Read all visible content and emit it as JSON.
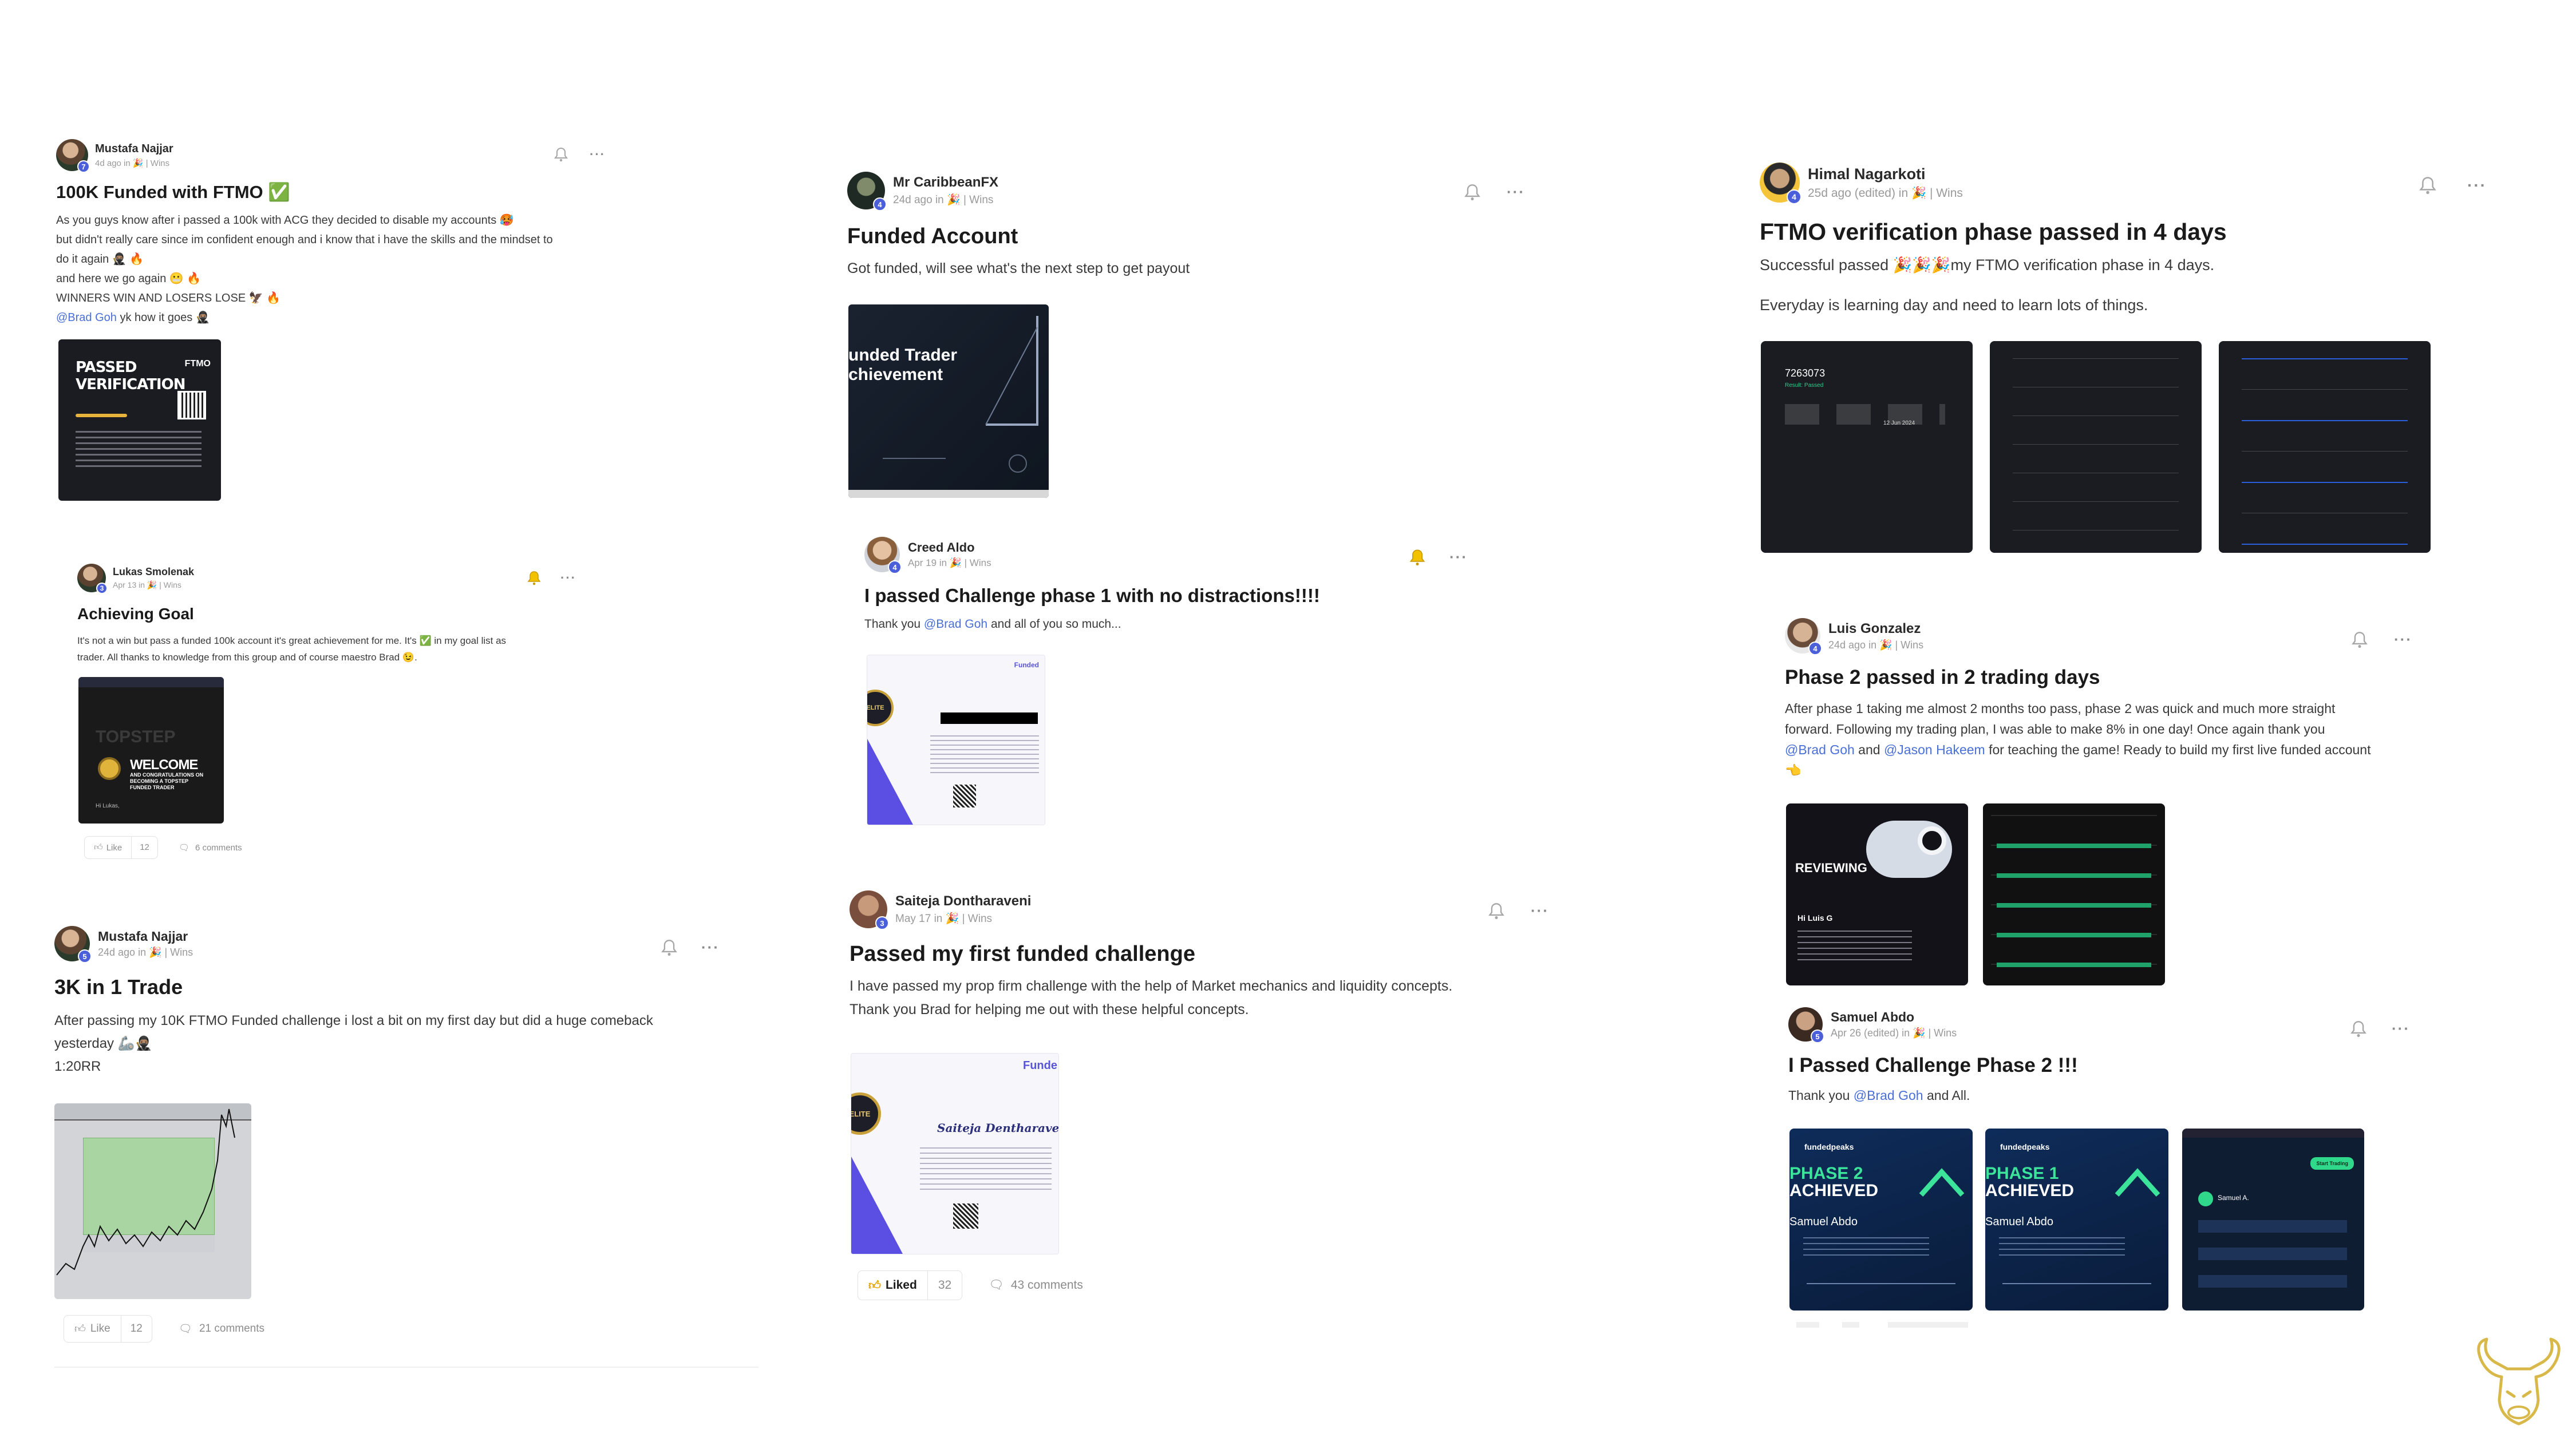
{
  "posts": [
    {
      "author": "Mustafa Najjar",
      "level": "7",
      "meta": "4d ago in 🎉 | Wins",
      "title": "100K Funded with FTMO ✅",
      "lines": [
        "As you guys know after i passed a 100k with ACG they decided to disable my accounts 🥵",
        "but didn't really care since im confident enough and i know that i have the skills and the mindset to",
        "do it again 🥷🏽 🔥",
        "and here we go again 😬 🔥",
        "WINNERS WIN AND LOSERS LOSE 🦅 🔥"
      ],
      "mention_line": {
        "mention": "@Brad Goh",
        "rest": " yk how it goes 🥷🏽"
      },
      "image": {
        "line1": "PASSED",
        "line2": "VERIFICATION",
        "brand": "FTMO"
      }
    },
    {
      "author": "Lukas Smolenak",
      "level": "3",
      "meta": "Apr 13 in 🎉 | Wins",
      "title": "Achieving Goal",
      "lines": [
        "It's not a win but pass a funded 100k account it's great achievement for me. It's ✅ in my goal list as",
        "trader. All thanks to knowledge from this group and of course maestro Brad 😉."
      ],
      "image": {
        "top": "TOPSTEP",
        "welcome": "WELCOME",
        "sub": "AND CONGRATULATIONS ON BECOMING A TOPSTEP FUNDED TRADER",
        "greet": "Hi Lukas,"
      },
      "like_label": "Like",
      "like_count": "12",
      "comments": "6 comments"
    },
    {
      "author": "Mustafa Najjar",
      "level": "5",
      "meta": "24d ago in 🎉 | Wins",
      "title": "3K in 1 Trade",
      "lines": [
        "After passing my 10K FTMO Funded challenge i lost a bit on my first day but did a huge comeback",
        "yesterday 🦾🥷🏽",
        "1:20RR"
      ],
      "like_label": "Like",
      "like_count": "12",
      "comments": "21 comments"
    },
    {
      "author": "Mr CaribbeanFX",
      "level": "4",
      "meta": "24d ago in 🎉 | Wins",
      "title": "Funded Account",
      "lines": [
        "Got funded, will see what's the next step to get payout"
      ],
      "image": {
        "line1": "unded Trader",
        "line2": "chievement"
      }
    },
    {
      "author": "Creed Aldo",
      "level": "4",
      "meta": "Apr 19 in 🎉 | Wins",
      "title": "I passed Challenge phase 1 with no distractions!!!!",
      "mention_line": {
        "pre": "Thank you ",
        "mention": "@Brad Goh",
        "rest": " and all of you so much..."
      },
      "image": {
        "brand": "Funded",
        "badge": "ELITE"
      }
    },
    {
      "author": "Saiteja Dontharaveni",
      "level": "3",
      "meta": "May 17 in 🎉 | Wins",
      "title": "Passed my first funded challenge",
      "lines": [
        "I have passed my prop firm challenge with the help of Market mechanics and liquidity concepts.",
        "Thank you Brad for helping me out with these helpful concepts."
      ],
      "image": {
        "brand": "Funde",
        "badge": "ELITE",
        "name": "Saiteja Dentharaveni"
      },
      "like_label": "Liked",
      "like_count": "32",
      "comments": "43 comments"
    },
    {
      "author": "Himal Nagarkoti",
      "level": "4",
      "meta": "25d ago (edited) in 🎉 | Wins",
      "title": "FTMO verification phase passed in 4 days",
      "lines": [
        "Successful passed 🎉🎉🎉my FTMO verification phase in 4 days.",
        "Everyday is learning day and need to learn lots of things."
      ],
      "image": {
        "account": "7263073",
        "status": "Result: Passed",
        "date": "12 Jun 2024"
      }
    },
    {
      "author": "Luis Gonzalez",
      "level": "4",
      "meta": "24d ago in 🎉 | Wins",
      "title": "Phase 2 passed in 2 trading days",
      "lines": [
        "After phase 1 taking me almost 2 months too pass, phase 2 was quick and much more straight",
        "forward. Following my trading plan, I was able to make 8% in one day! Once again thank you"
      ],
      "mention_line": {
        "mention": "@Brad Goh",
        "mid": " and ",
        "mention2": "@Jason Hakeem",
        "rest": " for teaching the game! Ready to build my first live funded account"
      },
      "tail": "👈",
      "image": {
        "label": "REVIEWING",
        "greet": "Hi Luis G"
      }
    },
    {
      "author": "Samuel Abdo",
      "level": "5",
      "meta": "Apr 26 (edited) in 🎉 | Wins",
      "title": "I Passed Challenge Phase 2 !!!",
      "mention_line": {
        "pre": "Thank you ",
        "mention": "@Brad Goh",
        "rest": " and All."
      },
      "image": {
        "brand": "fundedpeaks",
        "p2": "PHASE 2",
        "p1": "PHASE 1",
        "ach": "ACHIEVED",
        "name": "Samuel Abdo",
        "app_name": "Samuel A.",
        "btn": "Start Trading"
      }
    }
  ],
  "colors": {
    "accent": "#4a6fd6",
    "level_badge": "#4a5fd9",
    "liked": "#1c1c1c",
    "logo_gold": "#d9b84a"
  }
}
